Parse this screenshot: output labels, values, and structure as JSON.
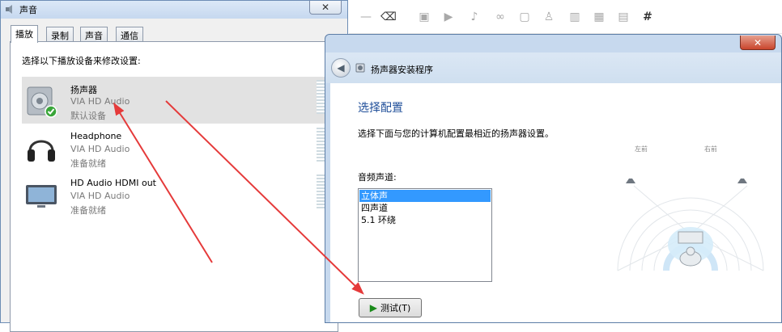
{
  "sound": {
    "title": "声音",
    "close": "✕",
    "tabs": [
      "播放",
      "录制",
      "声音",
      "通信"
    ],
    "instruction": "选择以下播放设备来修改设置:",
    "devices": [
      {
        "name": "扬声器",
        "driver": "VIA HD Audio",
        "status": "默认设备",
        "icon": "speaker-icon",
        "selected": true
      },
      {
        "name": "Headphone",
        "driver": "VIA HD Audio",
        "status": "准备就绪",
        "icon": "headphone-icon",
        "selected": false
      },
      {
        "name": "HD Audio HDMI out",
        "driver": "VIA HD Audio",
        "status": "准备就绪",
        "icon": "monitor-icon",
        "selected": false
      }
    ]
  },
  "setup": {
    "close": "✕",
    "title": "扬声器安装程序",
    "heading": "选择配置",
    "description": "选择下面与您的计算机配置最相近的扬声器设置。",
    "channel_label": "音频声道:",
    "options": [
      "立体声",
      "四声道",
      "5.1 环绕"
    ],
    "selected_option": "立体声",
    "test_button": "测试(T)",
    "speaker_labels": {
      "left": "左前",
      "right": "右前"
    }
  },
  "toolbar": {
    "icons": [
      "minus-icon",
      "eraser-icon",
      "image-icon",
      "video-icon",
      "music-icon",
      "link-icon",
      "file-icon",
      "user-icon",
      "chart-icon",
      "table-icon",
      "frame-icon",
      "hash-icon"
    ],
    "hash_glyph": "#"
  },
  "colors": {
    "accent_blue": "#1f4e99",
    "selection": "#3399ff",
    "arrow": "#e53a3a"
  }
}
